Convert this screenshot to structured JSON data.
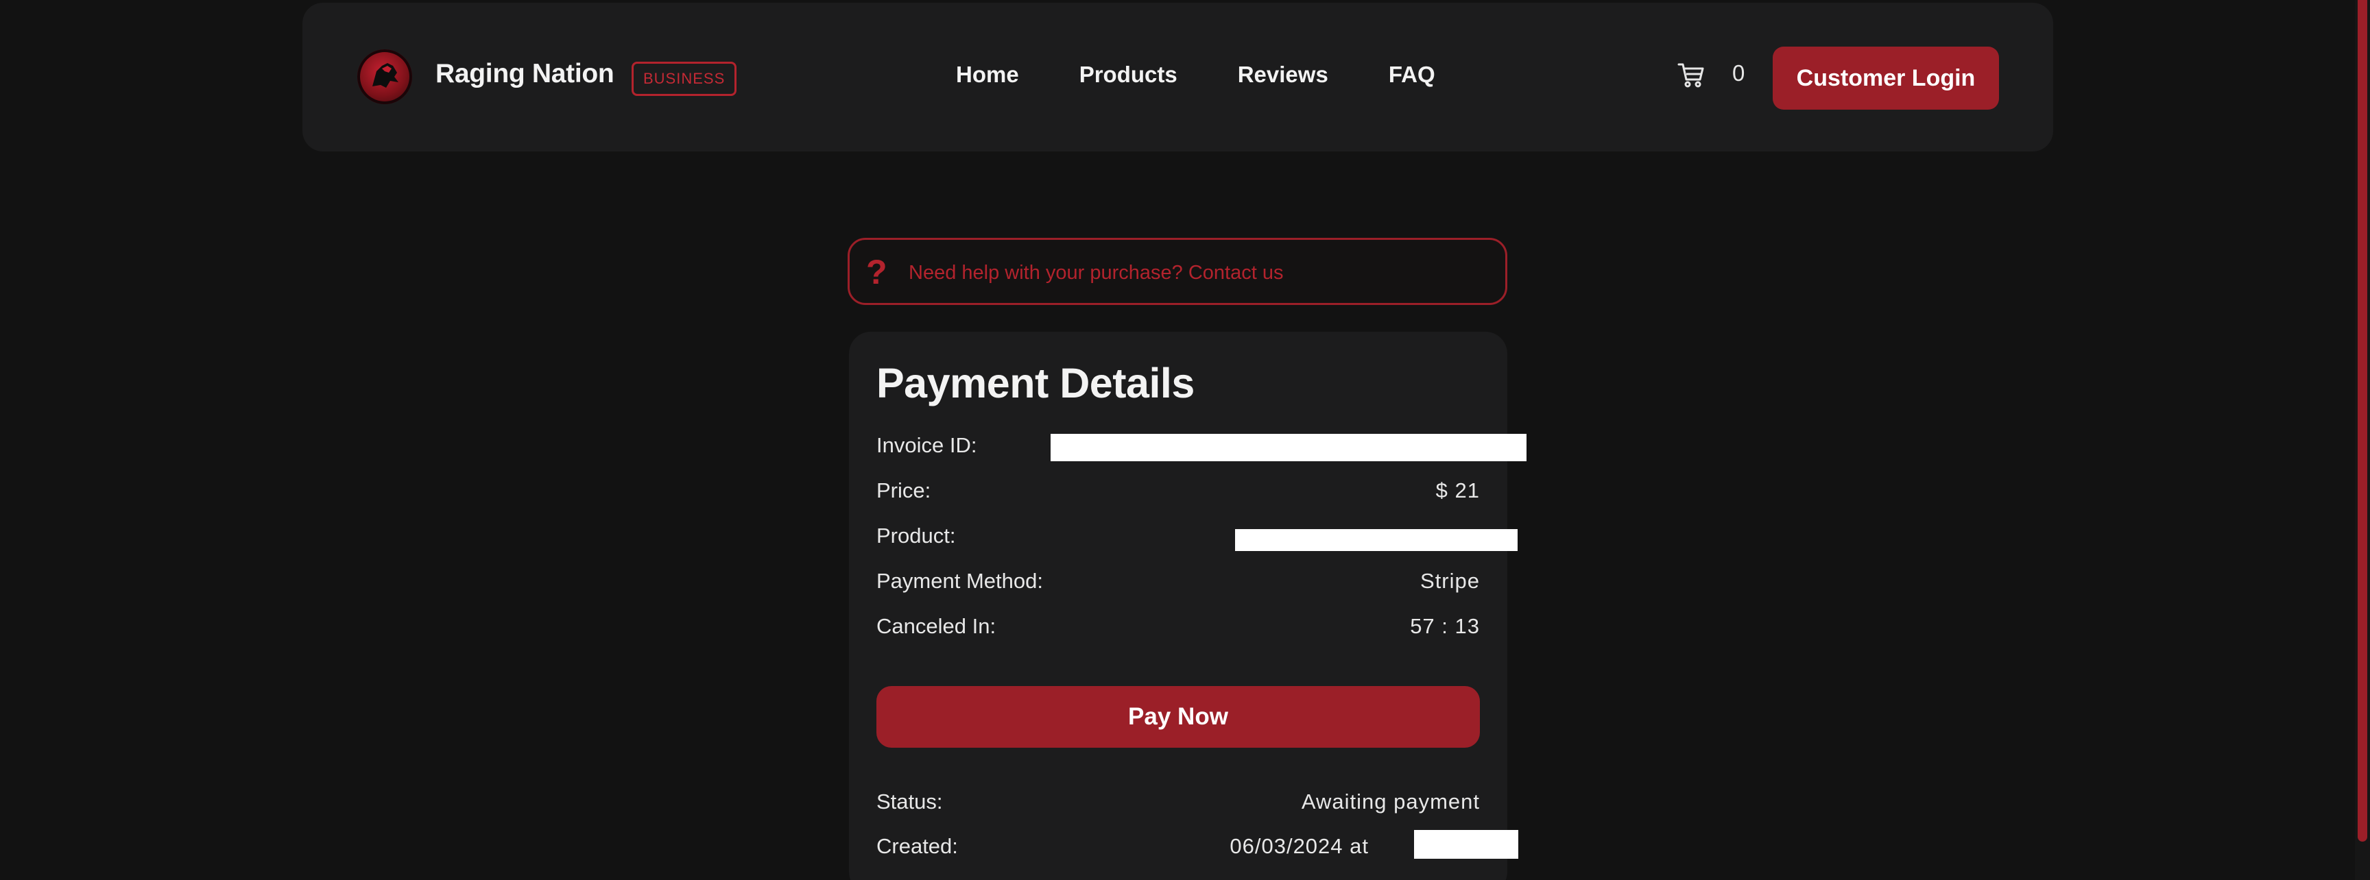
{
  "brand": {
    "name": "Raging Nation",
    "badge": "BUSINESS"
  },
  "nav": {
    "links": [
      "Home",
      "Products",
      "Reviews",
      "FAQ"
    ]
  },
  "cart": {
    "icon": "cart-icon",
    "count": "0"
  },
  "header": {
    "login_label": "Customer Login"
  },
  "help": {
    "icon": "?",
    "text": "Need help with your purchase? Contact us"
  },
  "payment": {
    "title": "Payment Details",
    "invoice_label": "Invoice ID:",
    "price_label": "Price:",
    "price_value": "$ 21",
    "product_label": "Product:",
    "method_label": "Payment Method:",
    "method_value": "Stripe",
    "canceled_label": "Canceled In:",
    "canceled_value": "57 : 13",
    "pay_label": "Pay Now",
    "status_label": "Status:",
    "status_value": "Awaiting payment",
    "created_label": "Created:",
    "created_value": "06/03/2024 at"
  },
  "colors": {
    "accent": "#9b1f28",
    "background": "#121212",
    "card": "#1c1c1d"
  }
}
